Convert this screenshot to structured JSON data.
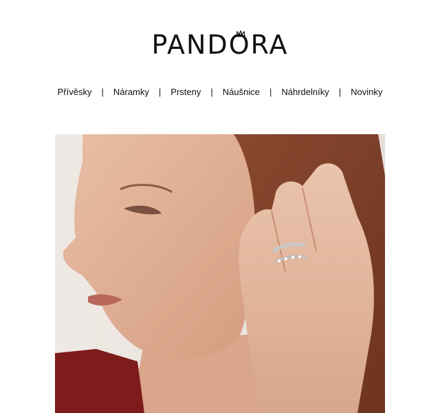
{
  "brand": {
    "logo_text": "PANDORA"
  },
  "nav": {
    "items": [
      {
        "label": "Přívěsky"
      },
      {
        "label": "Náramky"
      },
      {
        "label": "Prsteny"
      },
      {
        "label": "Náušnice"
      },
      {
        "label": "Náhrdelníky"
      },
      {
        "label": "Novinky"
      }
    ],
    "separator": "|"
  },
  "hero": {
    "image_name": "woman-wearing-mom-ring"
  }
}
